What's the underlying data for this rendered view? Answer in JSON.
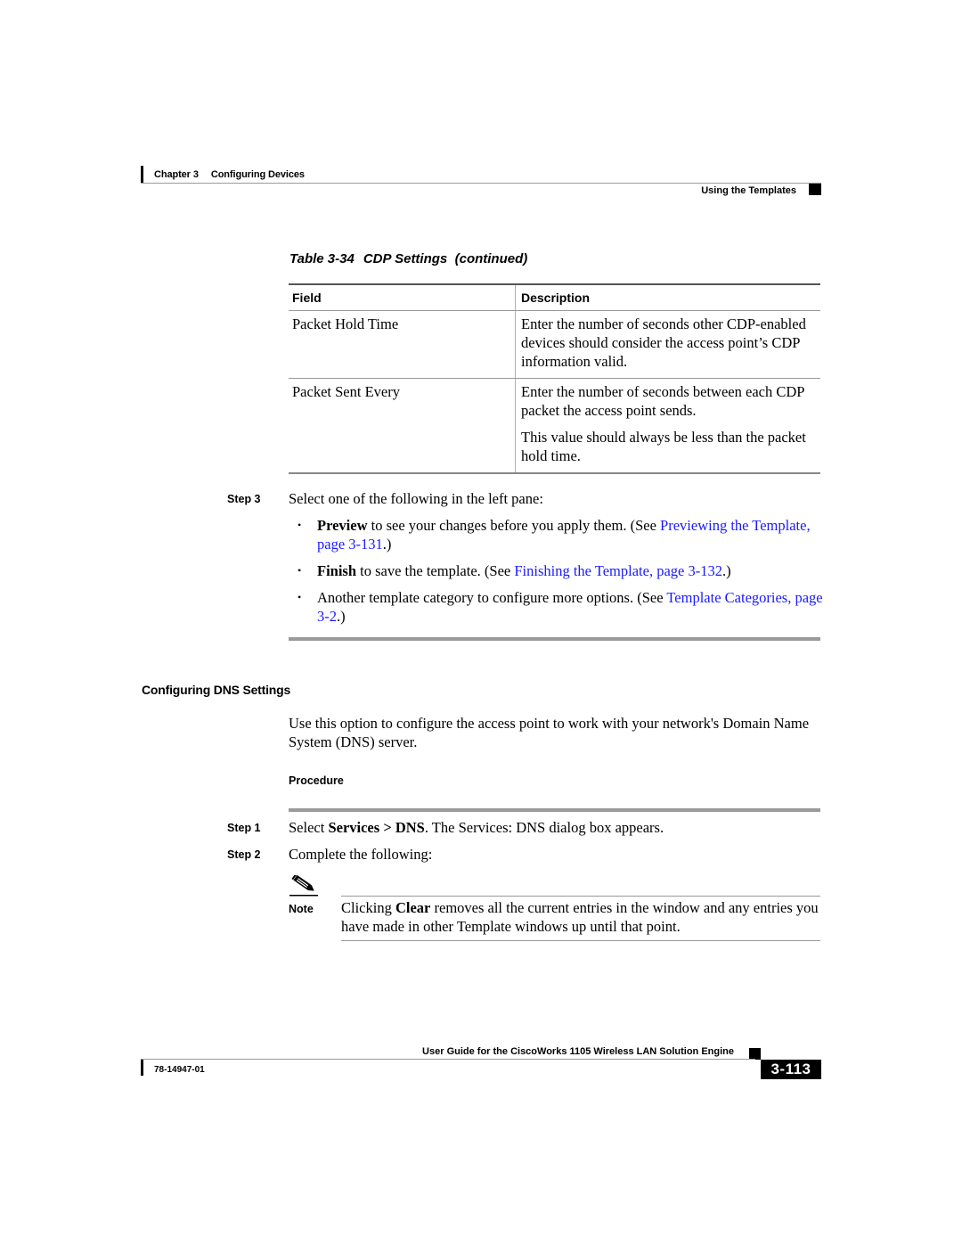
{
  "header": {
    "chapter_label": "Chapter 3",
    "chapter_title": "Configuring Devices",
    "section_title": "Using the Templates"
  },
  "table": {
    "number": "Table 3-34",
    "title": "CDP Settings  (continued)",
    "columns": [
      "Field",
      "Description"
    ],
    "rows": [
      {
        "field": "Packet Hold Time",
        "description": [
          "Enter the number of seconds other CDP-enabled devices should consider the access point’s CDP information valid."
        ]
      },
      {
        "field": "Packet Sent Every",
        "description": [
          "Enter the number of seconds between each CDP packet the access point sends.",
          "This value should always be less than the packet hold time."
        ]
      }
    ]
  },
  "step3": {
    "label": "Step 3",
    "text": "Select one of the following in the left pane:",
    "bullets": [
      {
        "bold": "Preview",
        "text": " to see your changes before you apply them. (See ",
        "link": "Previewing the Template, page 3-131",
        "after": ".)"
      },
      {
        "bold": "Finish",
        "text": " to save the template. (See ",
        "link": "Finishing the Template, page 3-132",
        "after": ".)"
      },
      {
        "bold": "",
        "text": "Another template category to configure more options. (See ",
        "link": "Template Categories, page 3-2",
        "after": ".)"
      }
    ]
  },
  "dns_section": {
    "heading": "Configuring DNS Settings",
    "intro": "Use this option to configure the access point to work with your network's Domain Name System (DNS) server.",
    "procedure_label": "Procedure",
    "steps": [
      {
        "label": "Step 1",
        "pre": "Select ",
        "bold1": "Services",
        "mid": " > ",
        "bold2": "DNS",
        "post": ". The Services: DNS dialog box appears."
      },
      {
        "label": "Step 2",
        "text": "Complete the following:"
      }
    ],
    "note": {
      "label": "Note",
      "pre": "Clicking ",
      "bold": "Clear",
      "post": " removes all the current entries in the window and any entries you have made in other Template windows up until that point."
    },
    "note_icon": "pencil-note-icon"
  },
  "footer": {
    "guide_title": "User Guide for the CiscoWorks 1105 Wireless LAN Solution Engine",
    "doc_number": "78-14947-01",
    "page_number": "3-113"
  },
  "colors": {
    "link": "#1a1aff",
    "rule": "#9a9a9a"
  }
}
